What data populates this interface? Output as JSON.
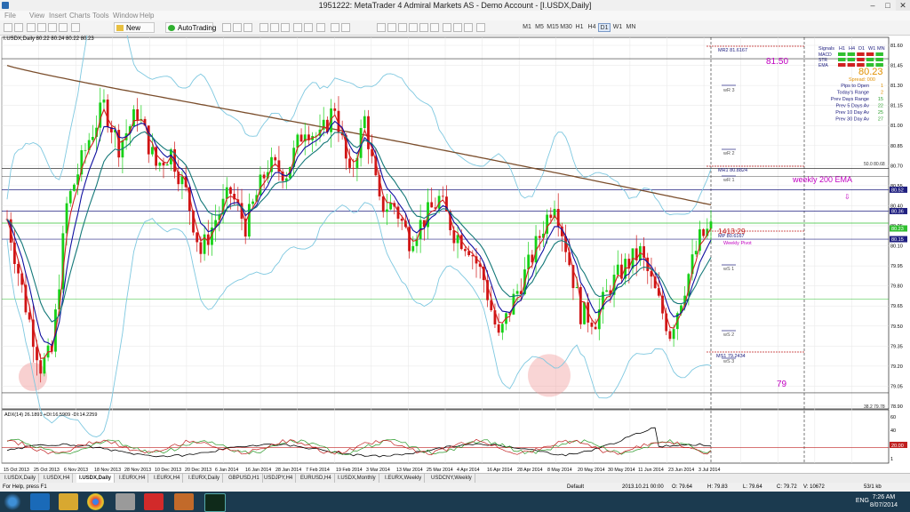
{
  "window": {
    "title": "1951222: MetaTrader 4 Admiral Markets AS - Demo Account - [I.USDX,Daily]",
    "minimize_glyph": "‒",
    "maximize_glyph": "□",
    "close_glyph": "✕"
  },
  "menu": [
    "File",
    "View",
    "Insert",
    "Charts",
    "Tools",
    "Window",
    "Help"
  ],
  "toolbar": {
    "new_order": "New Order",
    "auto_trading": "AutoTrading",
    "timeframes": [
      "M1",
      "M5",
      "M15",
      "M30",
      "H1",
      "H4",
      "D1",
      "W1",
      "MN"
    ],
    "active_timeframe": "D1"
  },
  "chart": {
    "header": "I.USDX,Daily  80.22 80.24 80.22 80.23",
    "annotations": {
      "level_high": "81.50",
      "level_low": "79",
      "weekly_ema": "weekly 200 EMA",
      "countdown": "1413:29",
      "mr2": "MR2  81.6167",
      "mr1": "MR1  80.8824",
      "mp": "MP  80.6167",
      "ms1": "MS1  79.2434",
      "weekly_pivot": "Weekly Pivot",
      "wr3": "wR 3",
      "wr2": "wR 2",
      "wr1": "wR 1",
      "ws1": "wS 1",
      "ws2": "wS 2",
      "ws3": "wS 3",
      "fib50": "50.0  80.68"
    },
    "panel": {
      "headers": [
        "Signals",
        "H1",
        "H4",
        "D1",
        "W1",
        "MN"
      ],
      "rows": [
        "MACD",
        "STR",
        "EMA"
      ],
      "price": "80.23",
      "spread": "Spread: 000",
      "stats": [
        {
          "label": "Pips to Open",
          "value": "1"
        },
        {
          "label": "Today's Range",
          "value": "2"
        },
        {
          "label": "Prev Days Range",
          "value": "15"
        },
        {
          "label": "Prev 5 Days Av",
          "value": "22"
        },
        {
          "label": "Prev 10 Day Av",
          "value": "25"
        },
        {
          "label": "Prev 30 Day Av",
          "value": "27"
        }
      ]
    },
    "price_axis": [
      "81.60",
      "81.45",
      "81.30",
      "81.15",
      "81.00",
      "80.85",
      "80.70",
      "80.55",
      "80.40",
      "80.25",
      "80.10",
      "79.95",
      "79.80",
      "79.65",
      "79.50",
      "79.35",
      "79.20",
      "79.05",
      "78.90"
    ],
    "price_tags": [
      "80.52",
      "80.36",
      "80.23",
      "80.15"
    ],
    "date_axis": [
      "15 Oct 2013",
      "25 Oct 2013",
      "6 Nov 2013",
      "18 Nov 2013",
      "28 Nov 2013",
      "10 Dec 2013",
      "20 Dec 2013",
      "6 Jan 2014",
      "16 Jan 2014",
      "28 Jan 2014",
      "7 Feb 2014",
      "19 Feb 2014",
      "3 Mar 2014",
      "13 Mar 2014",
      "25 Mar 2014",
      "4 Apr 2014",
      "16 Apr 2014",
      "28 Apr 2014",
      "8 May 2014",
      "20 May 2014",
      "30 May 2014",
      "11 Jun 2014",
      "23 Jun 2014",
      "3 Jul 2014"
    ],
    "adx": {
      "header": "ADX(14) 26.1891  +DI:16.5909  -DI:14.2259",
      "axis": [
        "60",
        "40",
        "20",
        "1"
      ],
      "level_tag": "20.00",
      "level_label": "38.2  79.78"
    }
  },
  "tabs": [
    "I.USDX,Daily",
    "I.USDX,H4",
    "I.USDX,Daily",
    "I.EURX,H4",
    "I.EURX,H4",
    "I.EURX,Daily",
    "GBPUSD,H1",
    "USDJPY,H4",
    "EURUSD,H4",
    "I.USDX,Monthly",
    "I.EURX,Weekly",
    "USDCNY,Weekly"
  ],
  "active_tab": 2,
  "status": {
    "help": "For Help, press F1",
    "profile": "Default",
    "datetime": "2013.10.21 00:00",
    "open": "O: 79.64",
    "high": "H: 79.83",
    "low": "L: 79.64",
    "close": "C: 79.72",
    "volume": "V: 10672",
    "traffic": "53/1 kb"
  },
  "taskbar": {
    "time": "7:26 AM",
    "date": "8/07/2014",
    "lang": "ENG"
  },
  "colors": {
    "bull": "#16d016",
    "bear": "#d01414",
    "ema_short": "#d22020",
    "ema_mid": "#1010a0",
    "ema_long": "#147878",
    "bollinger": "#7ec8e0",
    "ma200": "#7b4e2c",
    "magenta": "#c000c0",
    "adx": "#000000",
    "plus_di": "#2a9a2a",
    "minus_di": "#c02020"
  }
}
